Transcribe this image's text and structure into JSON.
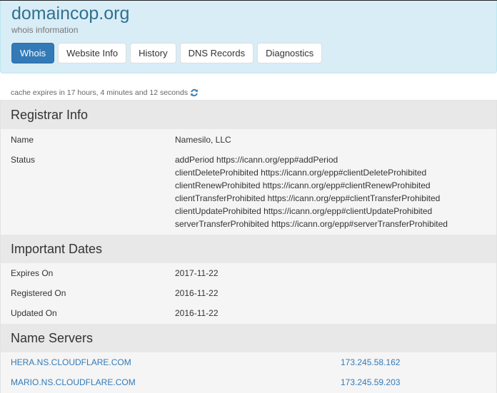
{
  "header": {
    "title": "domaincop.org",
    "subtitle": "whois information",
    "tabs": [
      {
        "label": "Whois",
        "active": true
      },
      {
        "label": "Website Info",
        "active": false
      },
      {
        "label": "History",
        "active": false
      },
      {
        "label": "DNS Records",
        "active": false
      },
      {
        "label": "Diagnostics",
        "active": false
      }
    ]
  },
  "cache": {
    "text": "cache expires in 17 hours, 4 minutes and 12 seconds",
    "icon": "refresh-icon"
  },
  "registrar": {
    "heading": "Registrar Info",
    "rows": [
      {
        "label": "Name",
        "value": "Namesilo, LLC"
      },
      {
        "label": "Status",
        "values": [
          "addPeriod https://icann.org/epp#addPeriod",
          "clientDeleteProhibited https://icann.org/epp#clientDeleteProhibited",
          "clientRenewProhibited https://icann.org/epp#clientRenewProhibited",
          "clientTransferProhibited https://icann.org/epp#clientTransferProhibited",
          "clientUpdateProhibited https://icann.org/epp#clientUpdateProhibited",
          "serverTransferProhibited https://icann.org/epp#serverTransferProhibited"
        ]
      }
    ]
  },
  "dates": {
    "heading": "Important Dates",
    "rows": [
      {
        "label": "Expires On",
        "value": "2017-11-22"
      },
      {
        "label": "Registered On",
        "value": "2016-11-22"
      },
      {
        "label": "Updated On",
        "value": "2016-11-22"
      }
    ]
  },
  "nameservers": {
    "heading": "Name Servers",
    "rows": [
      {
        "host": "HERA.NS.CLOUDFLARE.COM",
        "ip": "173.245.58.162"
      },
      {
        "host": "MARIO.NS.CLOUDFLARE.COM",
        "ip": "173.245.59.203"
      }
    ]
  },
  "colors": {
    "header_bg": "#d9edf7",
    "title": "#31708f",
    "active_tab": "#337ab7",
    "link": "#337ab7",
    "section_bg": "#e8e8e8",
    "panel_bg": "#f5f5f5"
  }
}
